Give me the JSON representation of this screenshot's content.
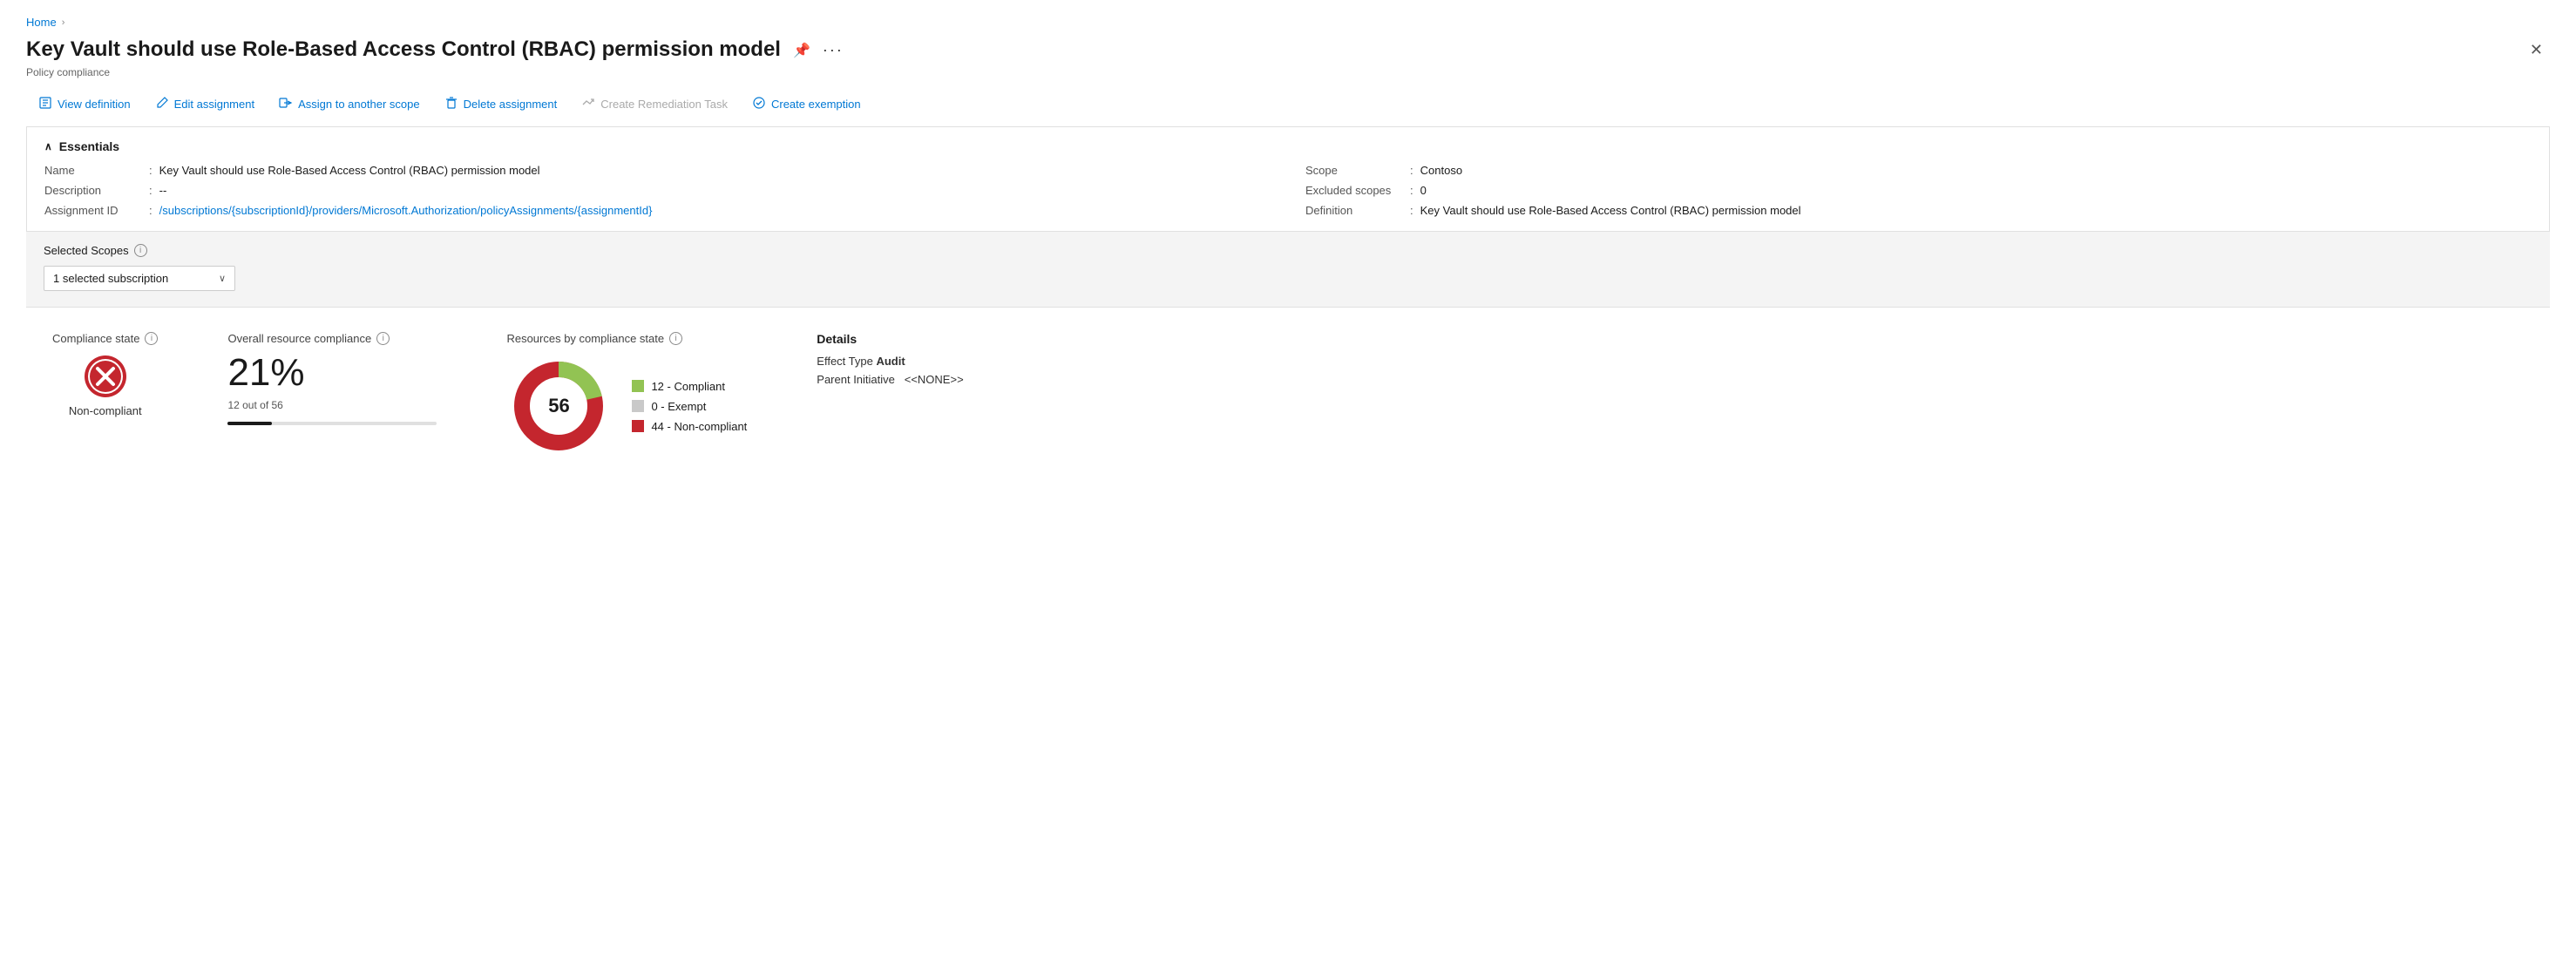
{
  "breadcrumb": {
    "home": "Home",
    "separator": "›"
  },
  "header": {
    "title": "Key Vault should use Role-Based Access Control (RBAC) permission model",
    "subtitle": "Policy compliance",
    "pin_label": "📌",
    "more_label": "···",
    "close_label": "✕"
  },
  "toolbar": {
    "view_definition": "View definition",
    "edit_assignment": "Edit assignment",
    "assign_to_another_scope": "Assign to another scope",
    "delete_assignment": "Delete assignment",
    "create_remediation_task": "Create Remediation Task",
    "create_exemption": "Create exemption"
  },
  "essentials": {
    "header": "Essentials",
    "name_label": "Name",
    "name_value": "Key Vault should use Role-Based Access Control (RBAC) permission model",
    "description_label": "Description",
    "description_value": "--",
    "assignment_id_label": "Assignment ID",
    "assignment_id_value": "/subscriptions/{subscriptionId}/providers/Microsoft.Authorization/policyAssignments/{assignmentId}",
    "scope_label": "Scope",
    "scope_value": "Contoso",
    "excluded_scopes_label": "Excluded scopes",
    "excluded_scopes_value": "0",
    "definition_label": "Definition",
    "definition_value": "Key Vault should use Role-Based Access Control (RBAC) permission model"
  },
  "scopes": {
    "label": "Selected Scopes",
    "dropdown_value": "1 selected subscription"
  },
  "compliance": {
    "state_title": "Compliance state",
    "state_value": "Non-compliant",
    "overall_title": "Overall resource compliance",
    "percentage": "21%",
    "fraction": "12 out of 56",
    "progress_percent": 21,
    "chart_title": "Resources by compliance state",
    "total": 56,
    "compliant": 12,
    "exempt": 0,
    "non_compliant": 44,
    "legend": [
      {
        "label": "12 - Compliant",
        "color": "#92c353"
      },
      {
        "label": "0 - Exempt",
        "color": "#c9c9c9"
      },
      {
        "label": "44 - Non-compliant",
        "color": "#c4262e"
      }
    ]
  },
  "details": {
    "title": "Details",
    "effect_type_label": "Effect Type",
    "effect_type_value": "Audit",
    "parent_initiative_label": "Parent Initiative",
    "parent_initiative_value": "<<NONE>>"
  }
}
